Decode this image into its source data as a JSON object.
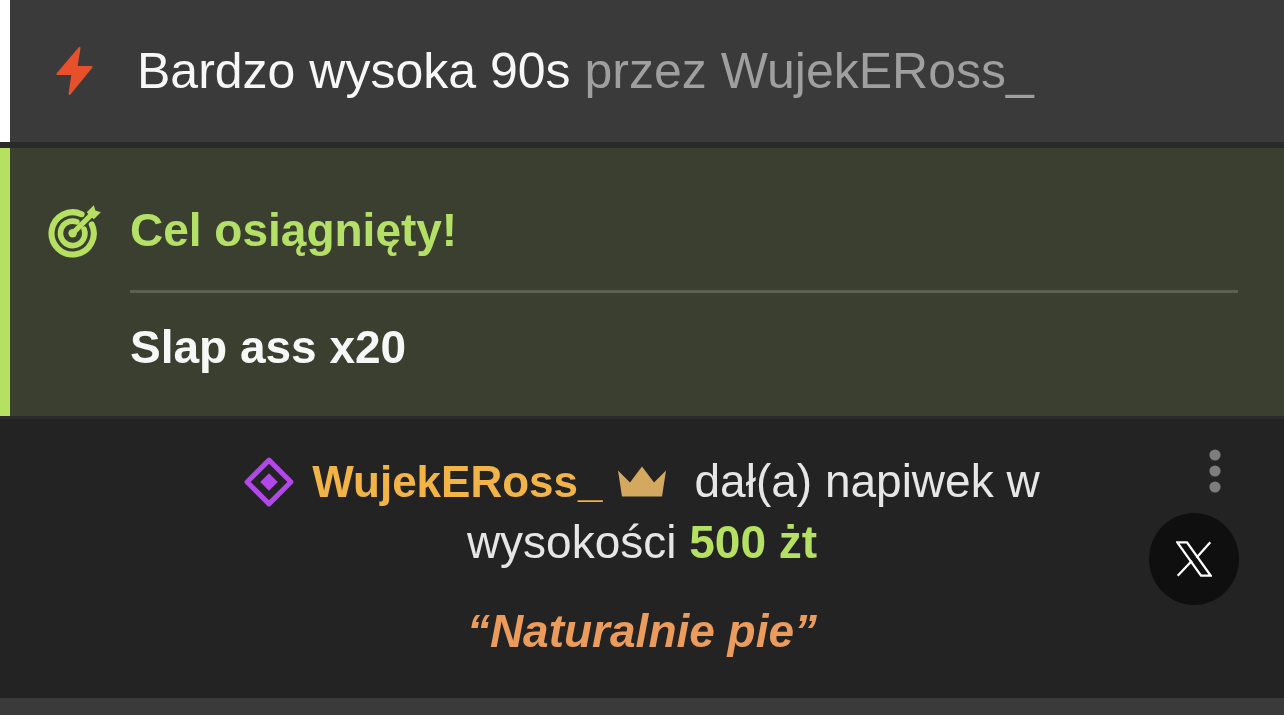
{
  "header": {
    "title": "Bardzo wysoka 90s",
    "byline": "przez WujekERoss_"
  },
  "goal": {
    "status": "Cel osiągnięty!",
    "name": "Slap ass x20"
  },
  "tip": {
    "username": "WujekERoss_",
    "message_lines": [
      "dał(a) napiwek w",
      "wysokości **500 żt**"
    ],
    "quote": "“Naturalnie pie”"
  }
}
